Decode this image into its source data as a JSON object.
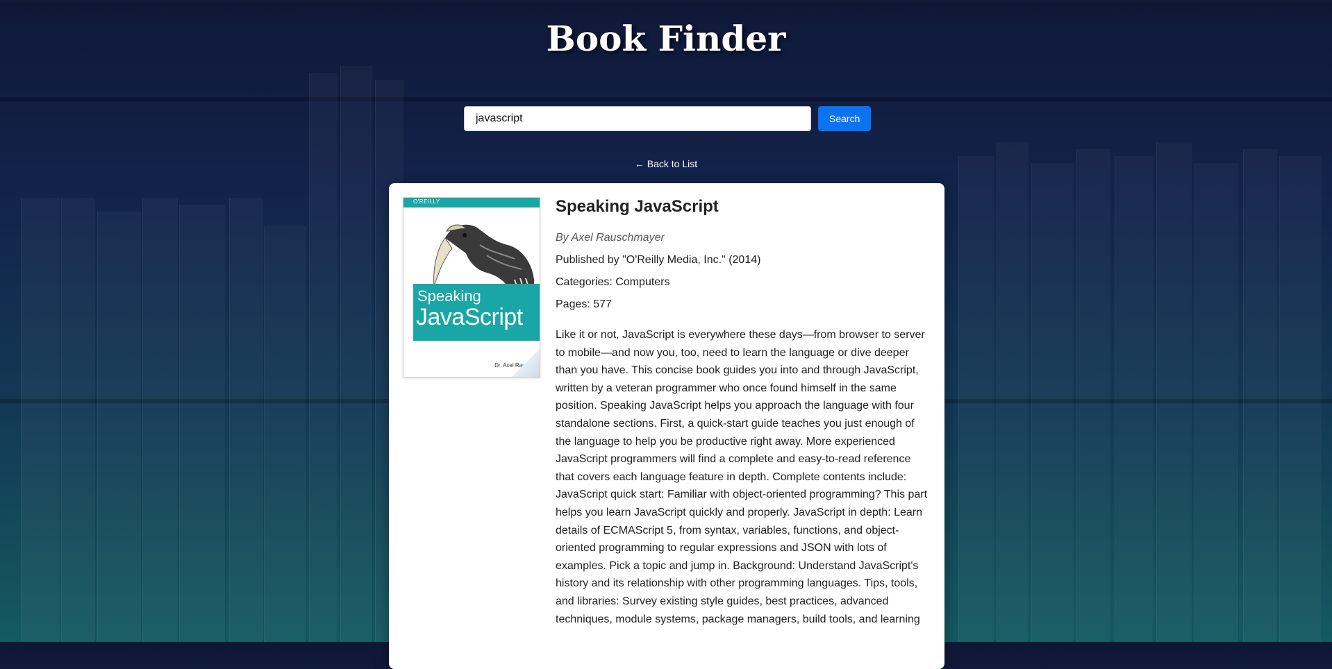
{
  "app": {
    "title": "Book Finder"
  },
  "search": {
    "value": "javascript",
    "button_label": "Search"
  },
  "nav": {
    "back_label": "← Back to List"
  },
  "book": {
    "title": "Speaking JavaScript",
    "author": "By Axel Rauschmayer",
    "publisher": "Published by \"O'Reilly Media, Inc.\" (2014)",
    "categories": "Categories: Computers",
    "pages": "Pages: 577",
    "description": "Like it or not, JavaScript is everywhere these days—from browser to server to mobile—and now you, too, need to learn the language or dive deeper than you have. This concise book guides you into and through JavaScript, written by a veteran programmer who once found himself in the same position. Speaking JavaScript helps you approach the language with four standalone sections. First, a quick-start guide teaches you just enough of the language to help you be productive right away. More experienced JavaScript programmers will find a complete and easy-to-read reference that covers each language feature in depth. Complete contents include: JavaScript quick start: Familiar with object-oriented programming? This part helps you learn JavaScript quickly and properly. JavaScript in depth: Learn details of ECMAScript 5, from syntax, variables, functions, and object-oriented programming to regular expressions and JSON with lots of examples. Pick a topic and jump in. Background: Understand JavaScript's history and its relationship with other programming languages. Tips, tools, and libraries: Survey existing style guides, best practices, advanced techniques, module systems, package managers, build tools, and learning",
    "cover": {
      "publisher_mark": "O'REILLY",
      "title_line1": "Speaking",
      "title_line2": "JavaScript",
      "author": "Dr. Axel Rausch"
    }
  },
  "colors": {
    "accent": "#0a74f0",
    "cover_teal": "#1aa6a6"
  }
}
